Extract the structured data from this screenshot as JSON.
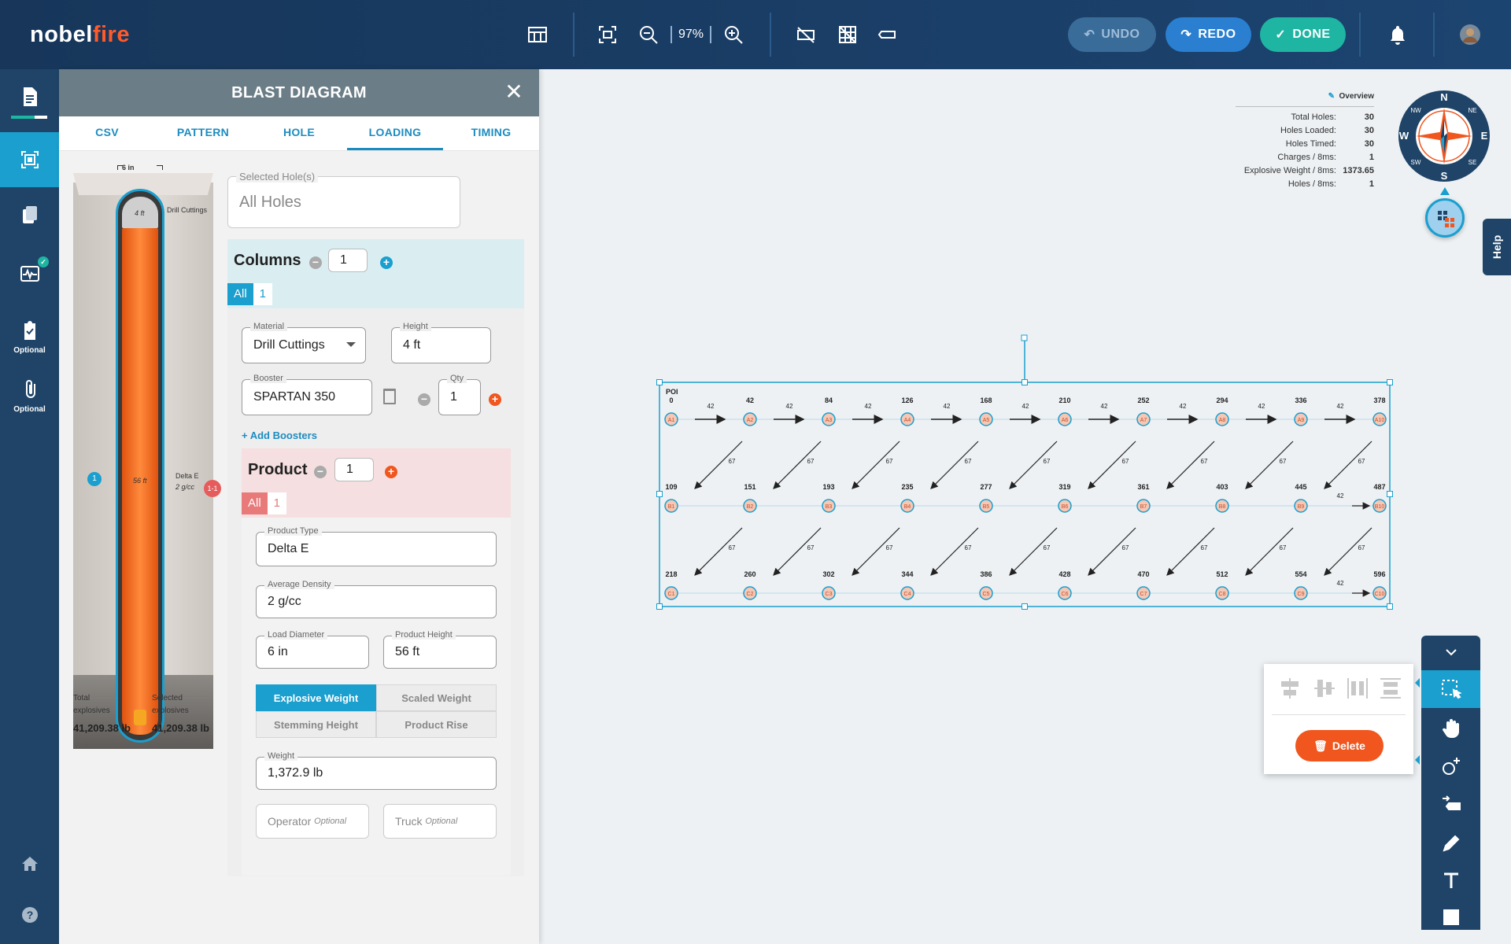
{
  "app": {
    "logo_main": "nobel",
    "logo_accent": "fire"
  },
  "toolbar": {
    "zoom": "97%",
    "undo": "UNDO",
    "redo": "REDO",
    "done": "DONE"
  },
  "nav": {
    "items": [
      {
        "name": "reports",
        "label": ""
      },
      {
        "name": "diagram",
        "label": ""
      },
      {
        "name": "documents",
        "label": ""
      },
      {
        "name": "vibration",
        "label": ""
      },
      {
        "name": "checklist",
        "label": "Optional"
      },
      {
        "name": "attachments",
        "label": "Optional"
      },
      {
        "name": "home",
        "label": ""
      },
      {
        "name": "help",
        "label": ""
      }
    ]
  },
  "panel": {
    "title": "BLAST DIAGRAM",
    "tabs": [
      "CSV",
      "PATTERN",
      "HOLE",
      "LOADING",
      "TIMING"
    ],
    "active_tab": "LOADING",
    "hole": {
      "diameter": "6 in",
      "cuttings_height": "4 ft",
      "cuttings_label": "Drill Cuttings",
      "product_height": "56 ft",
      "product_label": "Delta E",
      "product_density": "2 g/cc",
      "column_badge": "1",
      "product_badge": "1-1"
    },
    "totals": {
      "total_label": "Total explosives",
      "total_value": "41,209.38 lb",
      "selected_label": "Selected explosives",
      "selected_value": "41,209.38 lb"
    },
    "selected_holes": {
      "label": "Selected Hole(s)",
      "value": "All Holes"
    },
    "columns": {
      "label": "Columns",
      "count": "1",
      "seg_all": "All",
      "seg_1": "1"
    },
    "material": {
      "label": "Material",
      "value": "Drill Cuttings"
    },
    "height": {
      "label": "Height",
      "value": "4 ft"
    },
    "booster": {
      "label": "Booster",
      "value": "SPARTAN 350"
    },
    "qty": {
      "label": "Qty",
      "value": "1"
    },
    "add_boosters": "+ Add Boosters",
    "product": {
      "label": "Product",
      "count": "1",
      "seg_all": "All",
      "seg_1": "1"
    },
    "product_type": {
      "label": "Product Type",
      "value": "Delta E"
    },
    "avg_density": {
      "label": "Average Density",
      "value": "2 g/cc"
    },
    "load_diameter": {
      "label": "Load Diameter",
      "value": "6 in"
    },
    "product_height": {
      "label": "Product Height",
      "value": "56 ft"
    },
    "toggles": [
      "Explosive Weight",
      "Scaled Weight",
      "Stemming Height",
      "Product Rise"
    ],
    "weight": {
      "label": "Weight",
      "value": "1,372.9 lb"
    },
    "operator": {
      "label": "Operator",
      "hint": "Optional"
    },
    "truck": {
      "label": "Truck",
      "hint": "Optional"
    }
  },
  "overview": {
    "title": "Overview",
    "rows": [
      {
        "k": "Total Holes:",
        "v": "30"
      },
      {
        "k": "Holes Loaded:",
        "v": "30"
      },
      {
        "k": "Holes Timed:",
        "v": "30"
      },
      {
        "k": "Charges / 8ms:",
        "v": "1"
      },
      {
        "k": "Explosive Weight / 8ms:",
        "v": "1373.65"
      },
      {
        "k": "Holes / 8ms:",
        "v": "1"
      }
    ]
  },
  "compass": {
    "n": "N",
    "s": "S",
    "e": "E",
    "w": "W",
    "ne": "NE",
    "nw": "NW",
    "se": "SE",
    "sw": "SW"
  },
  "help": "Help",
  "pattern": {
    "poi_label": "POI",
    "rows": [
      {
        "prefix": "A",
        "times": [
          "0",
          "42",
          "84",
          "126",
          "168",
          "210",
          "252",
          "294",
          "336",
          "378"
        ]
      },
      {
        "prefix": "B",
        "times": [
          "109",
          "151",
          "193",
          "235",
          "277",
          "319",
          "361",
          "403",
          "445",
          "487"
        ]
      },
      {
        "prefix": "C",
        "times": [
          "218",
          "260",
          "302",
          "344",
          "386",
          "428",
          "470",
          "512",
          "554",
          "596"
        ]
      }
    ],
    "row_delay": "42",
    "diag_delay": "67"
  },
  "popover": {
    "delete": "Delete"
  },
  "colors": {
    "accent": "#1a9fcf",
    "navy": "#1f4468",
    "orange": "#f0561e",
    "teal": "#1eb5a2"
  }
}
